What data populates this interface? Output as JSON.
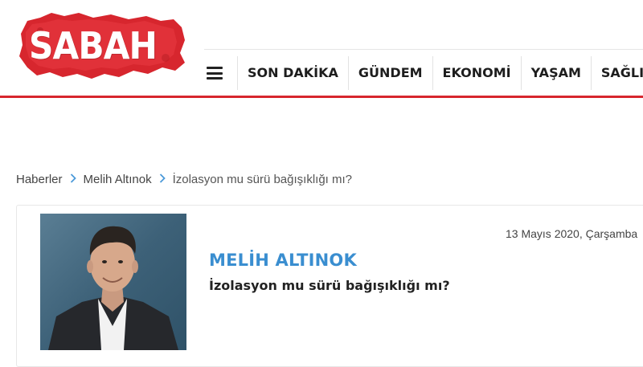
{
  "header": {
    "logo_text": "SABAH",
    "brand_color": "#d7262e",
    "menu_icon": "hamburger-menu-icon",
    "nav": [
      {
        "label": "SON DAKİKA"
      },
      {
        "label": "GÜNDEM"
      },
      {
        "label": "EKONOMİ"
      },
      {
        "label": "YAŞAM"
      },
      {
        "label": "SAĞLIK"
      }
    ]
  },
  "breadcrumb": {
    "items": [
      "Haberler",
      "Melih Altınok",
      "İzolasyon mu sürü bağışıklığı mı?"
    ],
    "separator_icon": "chevron-right-icon",
    "separator_color": "#4c9ad9"
  },
  "article": {
    "date": "13 Mayıs 2020, Çarşamba",
    "author": "MELİH ALTINOK",
    "author_color": "#3a8ed0",
    "title": "İzolasyon mu sürü bağışıklığı mı?"
  }
}
